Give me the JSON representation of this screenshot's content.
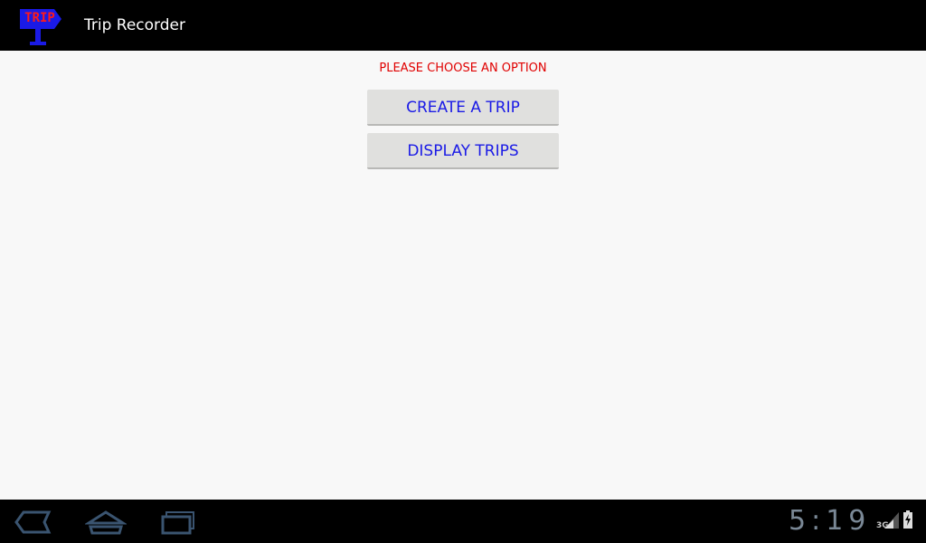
{
  "app": {
    "title": "Trip Recorder",
    "logo_text": "TRIP",
    "icon": "trip-signpost-icon"
  },
  "main": {
    "prompt": "PLEASE CHOOSE AN OPTION",
    "buttons": [
      {
        "label": "CREATE A TRIP"
      },
      {
        "label": "DISPLAY TRIPS"
      }
    ]
  },
  "status_bar": {
    "time": "5:19",
    "network": "3G",
    "nav_icons": [
      "back-icon",
      "home-icon",
      "recent-apps-icon"
    ],
    "status_icons": [
      "signal-icon",
      "battery-charging-icon"
    ]
  },
  "colors": {
    "prompt_text": "#e00000",
    "button_text": "#1a1ae6",
    "button_bg": "#e0e0de",
    "content_bg": "#f8f8f8",
    "logo_blue": "#1a1ae6",
    "logo_red": "#ff1a1a"
  }
}
